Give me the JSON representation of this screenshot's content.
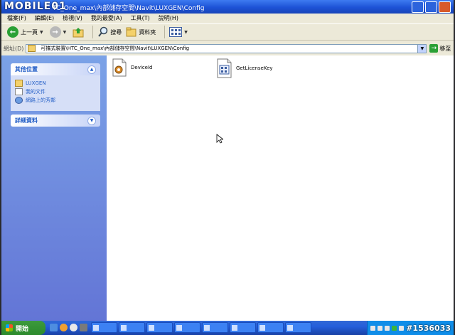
{
  "watermark": "MOBILE01",
  "window": {
    "title": "TC_One_max\\內部儲存空間\\Navit\\LUXGEN\\Config"
  },
  "menu": [
    "檔案(F)",
    "編輯(E)",
    "檢視(V)",
    "我的最愛(A)",
    "工具(T)",
    "說明(H)"
  ],
  "toolbar": {
    "back_label": "上一頁",
    "search_label": "搜尋",
    "folders_label": "資料夾"
  },
  "address": {
    "label": "網址(D)",
    "value": "可攜式裝置\\HTC_One_max\\內部儲存空間\\Navit\\LUXGEN\\Config",
    "go_label": "移至"
  },
  "sidebar": {
    "other_places": {
      "title": "其他位置",
      "items": [
        {
          "label": "LUXGEN",
          "icon": "folder-icon"
        },
        {
          "label": "我的文件",
          "icon": "my-documents-icon"
        },
        {
          "label": "網路上的芳鄰",
          "icon": "network-places-icon"
        }
      ]
    },
    "details": {
      "title": "詳細資料"
    }
  },
  "files": [
    {
      "name": "DeviceId",
      "icon": "settings-file-icon"
    },
    {
      "name": "GetLicenseKey",
      "icon": "registry-file-icon"
    }
  ],
  "taskbar": {
    "start_label": "開始",
    "stamp": "#1536033"
  },
  "colors": {
    "titlebar": "#1d52d6",
    "taskpane": "#7ba2e7",
    "start_button": "#2c8a2c"
  }
}
